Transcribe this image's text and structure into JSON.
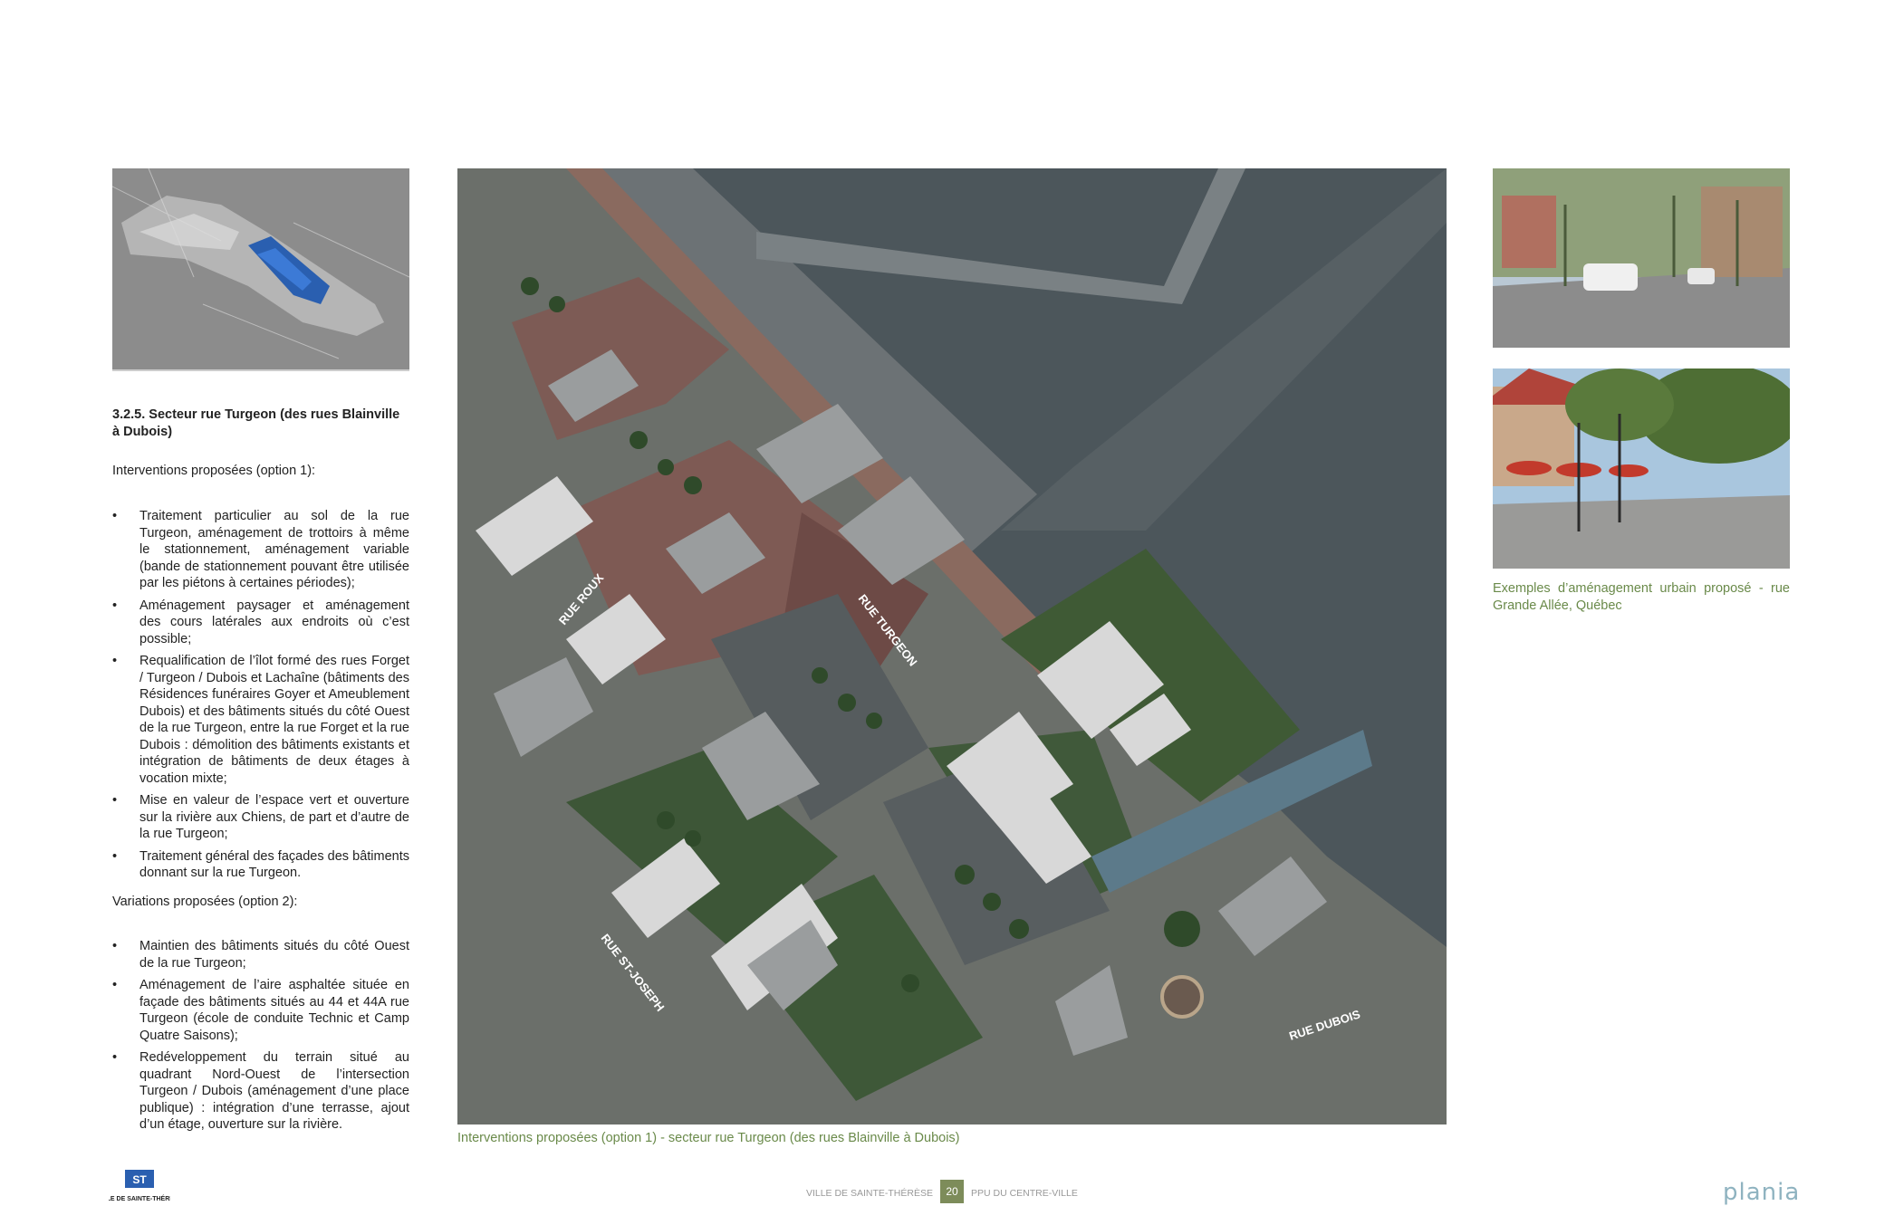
{
  "left": {
    "section_title": "3.2.5. Secteur rue Turgeon (des rues Blainville à Dubois)",
    "option1_heading": "Interventions proposées (option 1):",
    "option1_items": [
      "Traitement particulier au sol de la rue Turgeon, aménagement de trottoirs à même le stationnement, aménagement variable (bande de stationnement pouvant être utilisée par les piétons à certaines périodes);",
      "Aménagement paysager et aménagement des cours latérales aux endroits où c’est possible;",
      "Requalification de l’îlot formé des rues Forget / Turgeon / Dubois et Lachaîne (bâtiments des Résidences funéraires Goyer et Ameublement Dubois) et des bâtiments situés du côté Ouest de la rue Turgeon, entre la rue Forget et la rue Dubois : démolition des bâtiments existants et intégration de bâtiments de deux étages à vocation mixte;",
      "Mise en valeur de l’espace vert et ouverture sur la rivière aux Chiens, de part et d’autre de la rue Turgeon;",
      "Traitement général des façades des bâtiments donnant sur la rue Turgeon."
    ],
    "option2_heading": "Variations proposées (option 2):",
    "option2_items": [
      "Maintien des bâtiments situés du côté Ouest de la rue Turgeon;",
      "Aménagement de l’aire asphaltée située en façade des bâtiments situés au 44 et 44A rue Turgeon (école de conduite Technic et Camp Quatre Saisons);",
      "Redéveloppement du terrain situé au quadrant Nord-Ouest de l’intersection Turgeon / Dubois (aménagement d’une place publique) : intégration d’une terrasse, ajout d’un étage, ouverture sur la rivière."
    ]
  },
  "plan": {
    "street_labels": {
      "roux": "RUE ROUX",
      "turgeon": "RUE TURGEON",
      "st_joseph": "RUE ST-JOSEPH",
      "dubois": "RUE DUBOIS"
    },
    "caption": "Interventions proposées (option 1) - secteur rue Turgeon (des rues Blainville à Dubois)"
  },
  "photos": {
    "caption": "Exemples d’aménagement urbain proposé - rue Grande Allée, Québec"
  },
  "footer": {
    "city_logo_text": "VILLE DE SAINTE-THÉRÈSE",
    "city": "VILLE DE SAINTE-THÉRÈSE",
    "page_number": "20",
    "document": "PPU DU CENTRE-VILLE",
    "firm": "plania"
  },
  "colors": {
    "accent_green": "#6a8a4a",
    "page_badge": "#7d8c5a",
    "water": "#4a5458",
    "highlight_blue": "#2a5fb0"
  }
}
